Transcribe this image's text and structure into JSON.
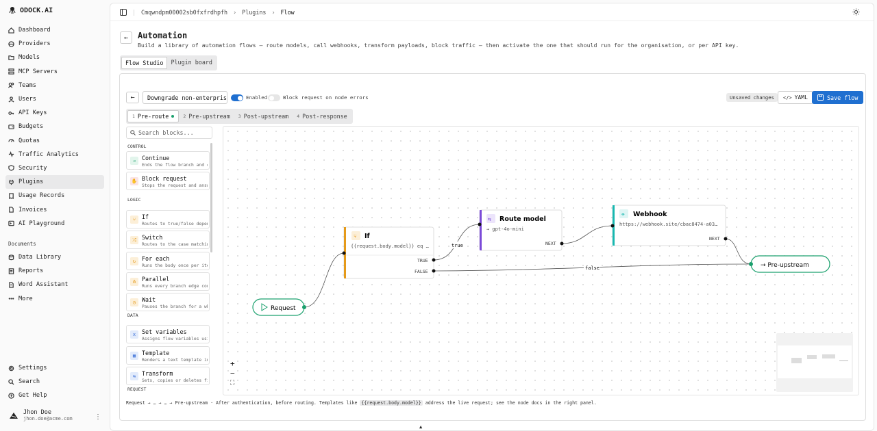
{
  "brand": "ODOCK.AI",
  "sidebar": {
    "items": [
      {
        "label": "Dashboard",
        "icon": "home-icon"
      },
      {
        "label": "Providers",
        "icon": "globe-icon"
      },
      {
        "label": "Models",
        "icon": "folder-icon"
      },
      {
        "label": "MCP Servers",
        "icon": "server-icon"
      },
      {
        "label": "Teams",
        "icon": "users-icon"
      },
      {
        "label": "Users",
        "icon": "user-icon"
      },
      {
        "label": "API Keys",
        "icon": "key-icon"
      },
      {
        "label": "Budgets",
        "icon": "wallet-icon"
      },
      {
        "label": "Quotas",
        "icon": "gauge-icon"
      },
      {
        "label": "Traffic Analytics",
        "icon": "activity-icon"
      },
      {
        "label": "Security",
        "icon": "shield-icon"
      },
      {
        "label": "Plugins",
        "icon": "plug-icon",
        "active": true
      },
      {
        "label": "Usage Records",
        "icon": "receipt-icon"
      },
      {
        "label": "Invoices",
        "icon": "file-icon"
      },
      {
        "label": "AI Playground",
        "icon": "terminal-icon"
      }
    ],
    "documents_heading": "Documents",
    "documents": [
      {
        "label": "Data Library",
        "icon": "database-icon"
      },
      {
        "label": "Reports",
        "icon": "report-icon"
      },
      {
        "label": "Word Assistant",
        "icon": "doc-icon"
      },
      {
        "label": "More",
        "icon": "more-icon"
      }
    ],
    "bottom": [
      {
        "label": "Settings",
        "icon": "gear-icon"
      },
      {
        "label": "Search",
        "icon": "search-icon"
      },
      {
        "label": "Get Help",
        "icon": "help-icon"
      }
    ],
    "user": {
      "name": "Jhon Doe",
      "email": "jhon.doe@acme.com"
    }
  },
  "breadcrumb": {
    "org": "Cmqwndpm00002sb0fxfrdhpfh",
    "section": "Plugins",
    "current": "Flow"
  },
  "page": {
    "title": "Automation",
    "subtitle": "Build a library of automation flows — route models, call webhooks, transform payloads, block traffic — then activate the one that should run for the organisation, or per API key.",
    "tabs": [
      {
        "label": "Flow Studio",
        "active": true
      },
      {
        "label": "Plugin board",
        "active": false
      }
    ]
  },
  "studio": {
    "flow_name": "Downgrade non-enterprise",
    "enabled_label": "Enabled",
    "enabled": true,
    "block_errors_label": "Block request on node errors",
    "block_errors": false,
    "unsaved": "Unsaved changes",
    "yaml_label": "YAML",
    "save_label": "Save flow",
    "stages": [
      {
        "num": "1",
        "label": "Pre-route",
        "active": true
      },
      {
        "num": "2",
        "label": "Pre-upstream",
        "active": false
      },
      {
        "num": "3",
        "label": "Post-upstream",
        "active": false
      },
      {
        "num": "4",
        "label": "Post-response",
        "active": false
      }
    ],
    "search_placeholder": "Search blocks...",
    "categories": {
      "control": "CONTROL",
      "logic": "LOGIC",
      "data": "DATA",
      "request": "REQUEST"
    },
    "blocks": [
      {
        "name": "Continue",
        "desc": "Ends the flow branch and continues",
        "color": "#1aa06d",
        "bg": "#e2f5ec",
        "icon": "→"
      },
      {
        "name": "Block request",
        "desc": "Stops the request and answers",
        "color": "#d94848",
        "bg": "#fbe4e4",
        "icon": "✋"
      },
      {
        "name": "If",
        "desc": "Routes to true/false depending",
        "color": "#e59a1a",
        "bg": "#fcefd8",
        "icon": "⑂"
      },
      {
        "name": "Switch",
        "desc": "Routes to the case matching",
        "color": "#e59a1a",
        "bg": "#fcefd8",
        "icon": "⤮"
      },
      {
        "name": "For each",
        "desc": "Runs the body once per item",
        "color": "#e59a1a",
        "bg": "#fcefd8",
        "icon": "↻"
      },
      {
        "name": "Parallel",
        "desc": "Runs every branch edge concurrently",
        "color": "#e59a1a",
        "bg": "#fcefd8",
        "icon": "⋔"
      },
      {
        "name": "Wait",
        "desc": "Pauses the branch for a while",
        "color": "#e59a1a",
        "bg": "#fcefd8",
        "icon": "◷"
      },
      {
        "name": "Set variables",
        "desc": "Assigns flow variables using",
        "color": "#3a6fd8",
        "bg": "#e2ebfb",
        "icon": "x"
      },
      {
        "name": "Template",
        "desc": "Renders a text template into",
        "color": "#3a6fd8",
        "bg": "#e2ebfb",
        "icon": "▦"
      },
      {
        "name": "Transform",
        "desc": "Sets, copies or deletes fields",
        "color": "#3a6fd8",
        "bg": "#e2ebfb",
        "icon": "⇆"
      }
    ],
    "nodes": {
      "request": "Request",
      "if_title": "If",
      "if_expr": "{{request.body.model}} eq …",
      "true_port": "TRUE",
      "false_port": "FALSE",
      "route_title": "Route model",
      "route_model": "→ gpt-4o-mini",
      "route_next": "NEXT",
      "webhook_title": "Webhook",
      "webhook_url": "https://webhook.site/cbac8474-a03…",
      "webhook_next": "NEXT",
      "end": "→ Pre-upstream",
      "edge_true": "true",
      "edge_false": "false"
    },
    "zoom": {
      "in": "+",
      "out": "−",
      "fit": "⛶"
    },
    "footer": {
      "prefix": "Request → … → … → Pre-upstream · After authentication, before routing. Templates like",
      "code": "{{request.body.model}}",
      "suffix": "address the live request; see the node docs in the right panel."
    },
    "colors": {
      "accent": "#1f6fd0",
      "if": "#e59a1a",
      "route": "#7b4ad8",
      "webhook": "#18b8b0",
      "start": "#1aa06d"
    }
  }
}
